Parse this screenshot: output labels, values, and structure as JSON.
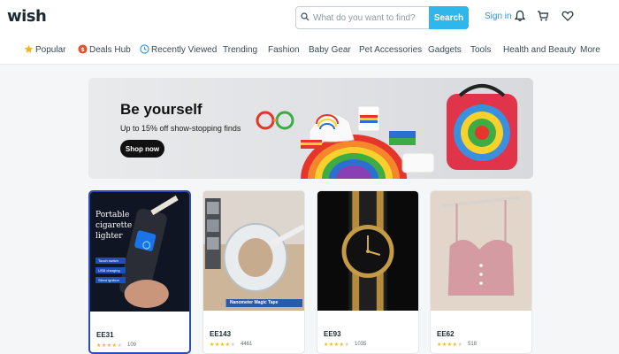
{
  "header": {
    "logo": "wish",
    "search_placeholder": "What do you want to find?",
    "search_button": "Search",
    "signin": "Sign in"
  },
  "nav": [
    {
      "label": "Popular"
    },
    {
      "label": "Deals Hub"
    },
    {
      "label": "Recently Viewed"
    },
    {
      "label": "Trending"
    },
    {
      "label": "Fashion"
    },
    {
      "label": "Baby Gear"
    },
    {
      "label": "Pet Accessories"
    },
    {
      "label": "Gadgets"
    },
    {
      "label": "Tools"
    },
    {
      "label": "Health and Beauty"
    },
    {
      "label": "More"
    }
  ],
  "banner": {
    "title": "Be yourself",
    "subtitle": "Up to 15% off show-stopping finds",
    "button": "Shop now"
  },
  "products": [
    {
      "price": "EE31",
      "rating": 4,
      "reviews": "109",
      "image_text": [
        "Portable",
        "cigarette",
        "lighter"
      ],
      "tags": [
        "Touch switch",
        "USB charging",
        "Silent ignition"
      ]
    },
    {
      "price": "EE143",
      "rating": 4,
      "reviews": "4461",
      "image_text": [
        "Nanometer Magic Tape"
      ]
    },
    {
      "price": "EE93",
      "rating": 4,
      "reviews": "1035"
    },
    {
      "price": "EE62",
      "rating": 4,
      "reviews": "518"
    }
  ],
  "colors": {
    "accent": "#2fb7ec",
    "link": "#2c8eea",
    "star": "#f5b519"
  }
}
